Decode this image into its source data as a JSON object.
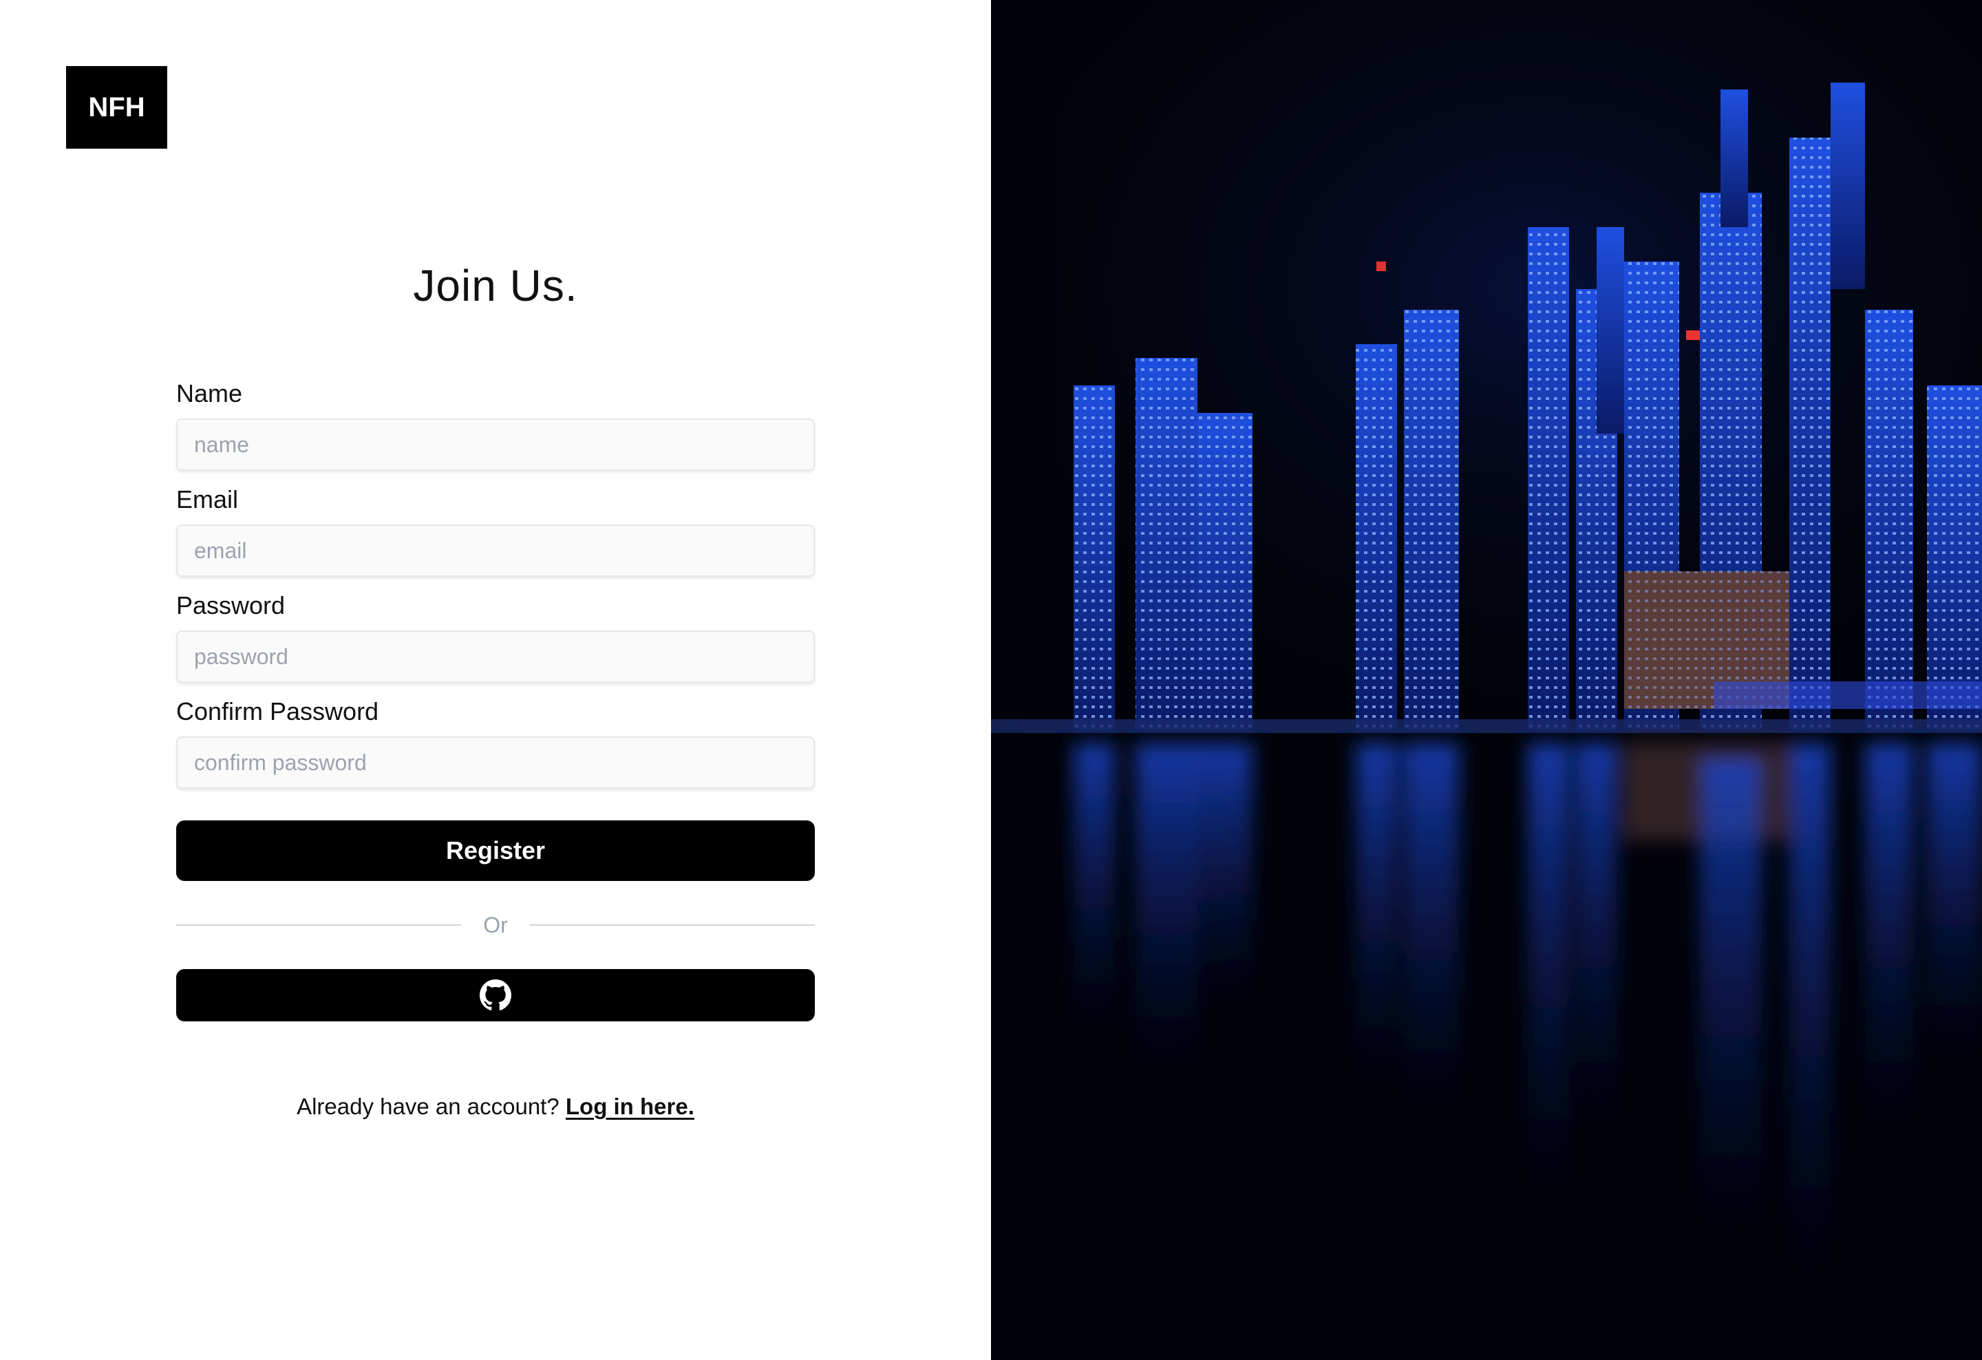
{
  "logo": {
    "text": "NFH"
  },
  "form": {
    "title": "Join Us.",
    "fields": [
      {
        "label": "Name",
        "placeholder": "name",
        "value": ""
      },
      {
        "label": "Email",
        "placeholder": "email",
        "value": ""
      },
      {
        "label": "Password",
        "placeholder": "password",
        "value": ""
      },
      {
        "label": "Confirm Password",
        "placeholder": "confirm password",
        "value": ""
      }
    ],
    "register_label": "Register",
    "divider_text": "Or",
    "github_icon": "github-icon",
    "footer_prompt": "Already have an account?",
    "footer_link": "Log in here."
  },
  "colors": {
    "primary": "#000000",
    "background": "#ffffff",
    "placeholder": "#9ca3af",
    "image_accent": "#1e4fd8"
  }
}
